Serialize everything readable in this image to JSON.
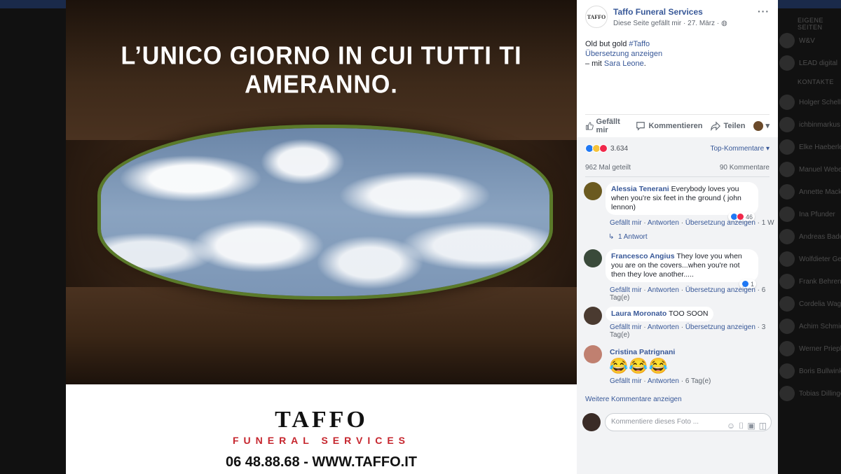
{
  "photo": {
    "headline": "L’UNICO GIORNO IN CUI TUTTI TI AMERANNO.",
    "brand": "TAFFO",
    "brand_sub": "FUNERAL SERVICES",
    "contact": "06 48.88.68 - WWW.TAFFO.IT"
  },
  "post": {
    "avatar_text": "TAFFO",
    "page_name": "Taffo Funeral Services",
    "meta": "Diese Seite gefällt mir · 27. März · ",
    "text_main": "Old but gold ",
    "hashtag": "#Taffo",
    "translate": "Übersetzung anzeigen",
    "with_prefix": "– mit ",
    "with_name": "Sara Leone",
    "with_suffix": "."
  },
  "actions": {
    "like": "Gefällt mir",
    "comment": "Kommentieren",
    "share": "Teilen"
  },
  "stats": {
    "reaction_count": "3.634",
    "top_comments": "Top-Kommentare ▾",
    "shares": "962 Mal geteilt",
    "comments": "90 Kommentare"
  },
  "comments": [
    {
      "name": "Alessia Tenerani",
      "text_1": " Everybody loves you",
      "text_2": "when you're six feet in the ground ( john",
      "text_3": "lennon)",
      "reaction_count": "46",
      "like": "Gefällt mir",
      "reply": "Antworten",
      "translate": "Übersetzung anzeigen",
      "time": "1 W",
      "replies": "1 Antwort"
    },
    {
      "name": "Francesco Angius",
      "text_1": " They love you when",
      "text_2": "you are on the covers...when you're not",
      "text_3": "then they love another.....",
      "reaction_count": "1",
      "like": "Gefällt mir",
      "reply": "Antworten",
      "translate": "Übersetzung anzeigen",
      "time_1": "6",
      "time_2": "Tag(e)"
    },
    {
      "name": "Laura Moronato",
      "text_1": " TOO SOON",
      "like": "Gefällt mir",
      "reply": "Antworten",
      "translate": "Übersetzung anzeigen",
      "time_1": "3",
      "time_2": "Tag(e)"
    },
    {
      "name": "Cristina Patrignani",
      "emojis": "😂😂😂",
      "like": "Gefällt mir",
      "reply": "Antworten",
      "time": "6 Tag(e)"
    }
  ],
  "more_comments": "Weitere Kommentare anzeigen",
  "composer": {
    "placeholder": "Kommentiere dieses Foto ..."
  },
  "right_sidebar": {
    "pages_title": "EIGENE SEITEN",
    "pages": [
      "W&V",
      "LEAD digital"
    ],
    "contacts_title": "KONTAKTE",
    "contacts": [
      "Holger Schellkopf",
      "ichbinmarkus",
      "Elke Haeberle",
      "Manuel Weber",
      "Annette Mack",
      "Ina Pfunder",
      "Andreas Bader",
      "Wolfdieter Gerhold",
      "Frank Behrens",
      "Cordelia Wagner",
      "Achim Schmid",
      "Werner Priepke",
      "Boris Bullwinkel",
      "Tobias Dillinger"
    ]
  },
  "colors": {
    "link": "#385898",
    "brand_red": "#c6262e",
    "like_blue": "#2078f4"
  }
}
